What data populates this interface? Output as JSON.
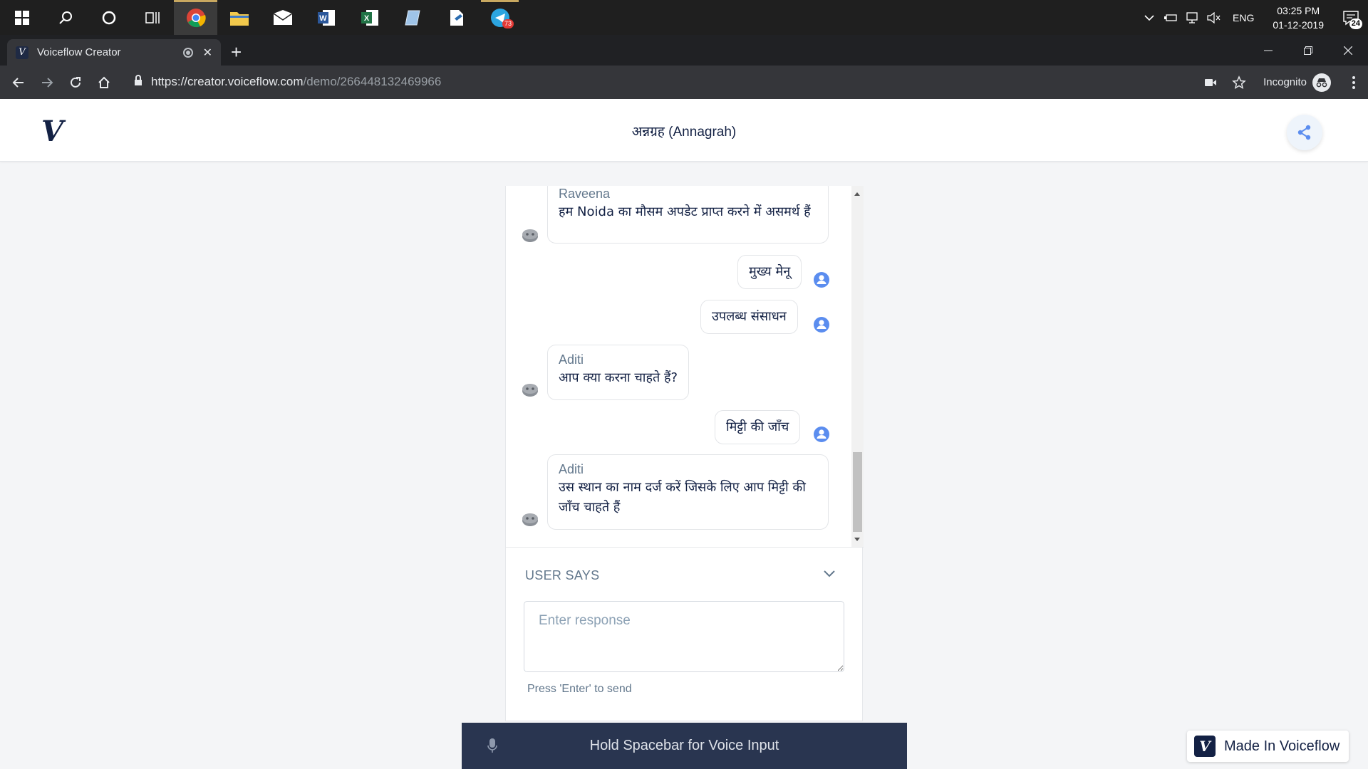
{
  "taskbar": {
    "apps": [
      "start",
      "search",
      "cortana",
      "task-view",
      "chrome",
      "file-explorer",
      "mail",
      "word",
      "excel",
      "notepad",
      "document",
      "telegram"
    ],
    "telegram_badge": "73",
    "tray": {
      "language": "ENG",
      "time": "03:25 PM",
      "date": "01-12-2019",
      "notifications": "24"
    }
  },
  "browser": {
    "tab_title": "Voiceflow Creator",
    "url_host": "https://creator.voiceflow.com",
    "url_path": "/demo/266448132469966",
    "profile_label": "Incognito"
  },
  "app": {
    "project_title": "अन्नग्रह (Annagrah)"
  },
  "chat": {
    "messages": [
      {
        "role": "bot",
        "speaker": "Raveena",
        "text": "हम Noida का मौसम अपडेट प्राप्त करने में असमर्थ हैं"
      },
      {
        "role": "user",
        "text": "मुख्य मेनू"
      },
      {
        "role": "user",
        "text": "उपलब्ध संसाधन"
      },
      {
        "role": "bot",
        "speaker": "Aditi",
        "text": "आप क्या करना चाहते हैं?"
      },
      {
        "role": "user",
        "text": "मिट्टी की जाँच"
      },
      {
        "role": "bot",
        "speaker": "Aditi",
        "text": "उस स्थान का नाम दर्ज करें जिसके लिए आप मिट्टी की जाँच चाहते हैं"
      }
    ]
  },
  "input": {
    "section_label": "USER SAYS",
    "placeholder": "Enter response",
    "hint": "Press 'Enter' to send"
  },
  "voice": {
    "label": "Hold Spacebar for Voice Input"
  },
  "badge": {
    "label": "Made In Voiceflow"
  },
  "colors": {
    "brand_navy": "#132144",
    "voice_bar": "#293550",
    "user_avatar": "#5b8def",
    "share_icon": "#5b8def"
  }
}
